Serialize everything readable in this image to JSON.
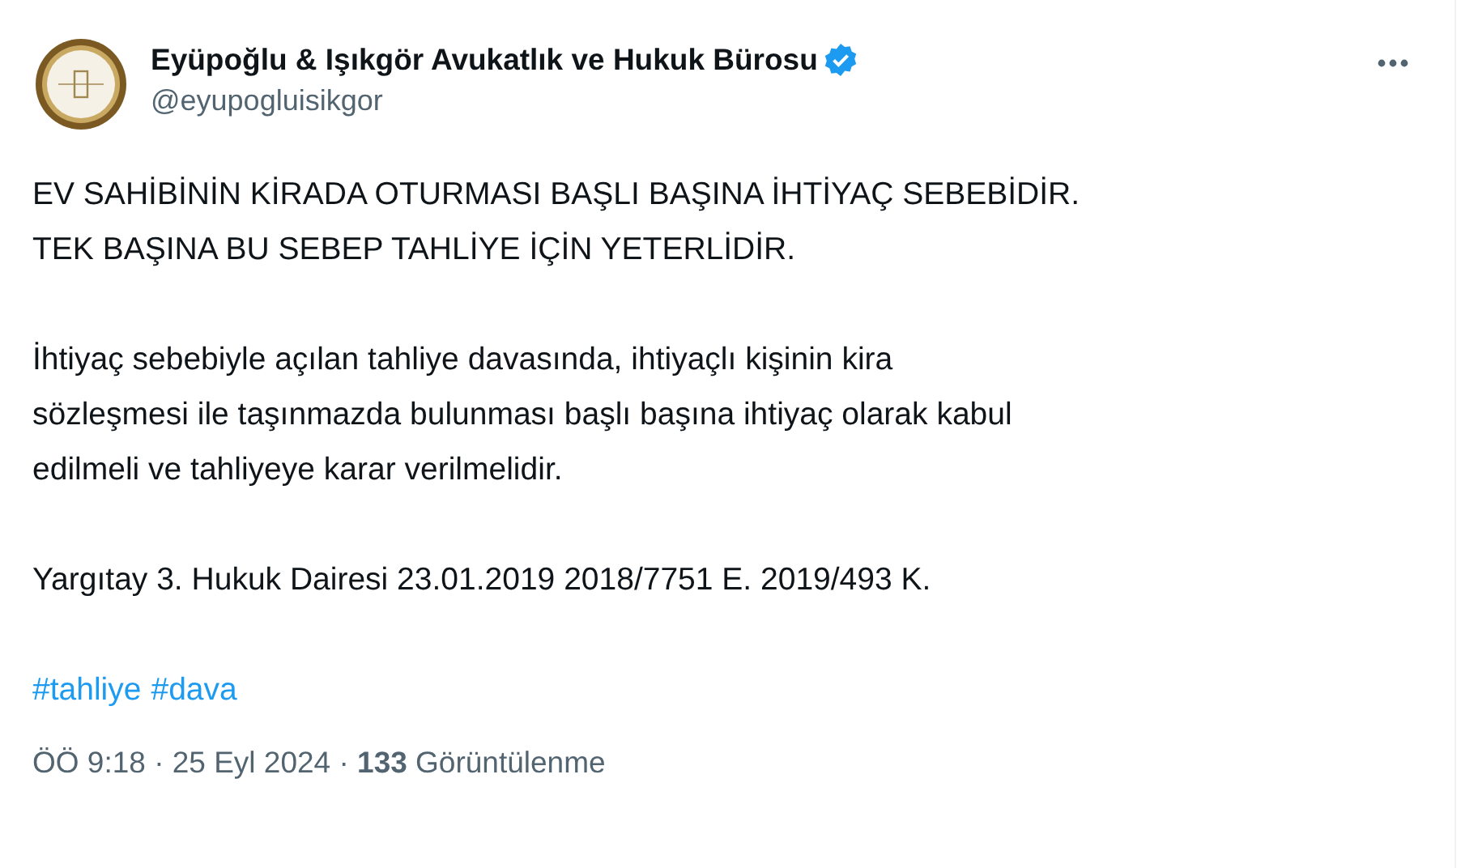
{
  "author": {
    "name": "Eyüpoğlu & Işıkgör Avukatlık ve Hukuk Bürosu",
    "verified": true,
    "handle": "@eyupogluisikgor"
  },
  "paragraphs": [
    [
      "EV SAHİBİNİN KİRADA OTURMASI BAŞLI BAŞINA İHTİYAÇ SEBEBİDİR.",
      "TEK BAŞINA BU SEBEP TAHLİYE İÇİN YETERLİDİR."
    ],
    [
      "İhtiyaç sebebiyle açılan tahliye davasında, ihtiyaçlı kişinin kira",
      "sözleşmesi ile taşınmazda bulunması başlı başına ihtiyaç olarak kabul",
      "edilmeli ve tahliyeye karar verilmelidir."
    ],
    [
      "Yargıtay 3. Hukuk Dairesi 23.01.2019 2018/7751 E. 2019/493 K."
    ]
  ],
  "hashtags": [
    "#tahliye",
    "#dava"
  ],
  "meta": "ÖÖ 9:18 · 25 Eyl 2024 · **133** Görüntülenme"
}
